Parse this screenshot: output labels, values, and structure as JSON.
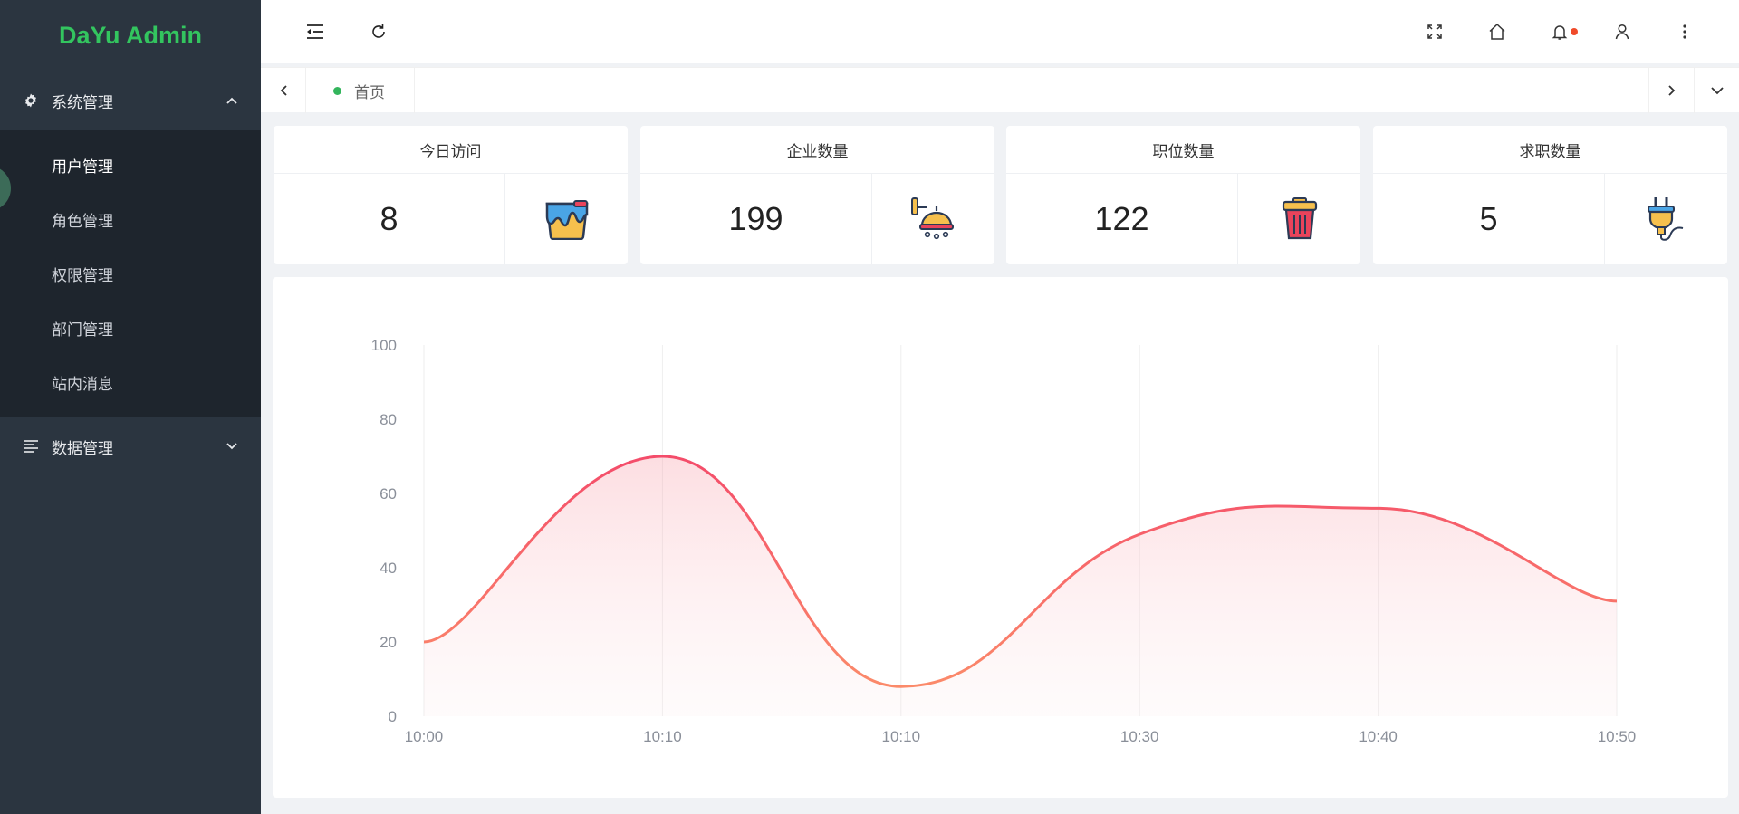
{
  "app": {
    "brand": "DaYu Admin"
  },
  "sidebar": {
    "groups": [
      {
        "label": "系统管理",
        "icon": "gear-icon",
        "expanded": true,
        "items": [
          {
            "label": "用户管理",
            "active": true
          },
          {
            "label": "角色管理"
          },
          {
            "label": "权限管理"
          },
          {
            "label": "部门管理"
          },
          {
            "label": "站内消息"
          }
        ]
      },
      {
        "label": "数据管理",
        "icon": "list-icon",
        "expanded": false
      }
    ]
  },
  "topbar": {
    "left_icons": [
      "menu-fold-icon",
      "refresh-icon"
    ],
    "right_icons": [
      "fullscreen-icon",
      "home-icon",
      "bell-icon",
      "user-icon",
      "more-vertical-icon"
    ],
    "notification_dot": true
  },
  "tabs": {
    "items": [
      {
        "label": "首页",
        "active": true
      }
    ]
  },
  "stats": [
    {
      "title": "今日访问",
      "value": "8",
      "icon": "paint-bucket-icon"
    },
    {
      "title": "企业数量",
      "value": "199",
      "icon": "shower-icon"
    },
    {
      "title": "职位数量",
      "value": "122",
      "icon": "trash-can-icon"
    },
    {
      "title": "求职数量",
      "value": "5",
      "icon": "plug-icon"
    }
  ],
  "colors": {
    "brand": "#33c55f",
    "sidebar": "#2b3540",
    "submenu": "#1e252d",
    "line": "#f5606f",
    "accent_dot": "#33b55c"
  },
  "chart_data": {
    "type": "area",
    "categories": [
      "10:00",
      "10:10",
      "10:10",
      "10:30",
      "10:40",
      "10:50"
    ],
    "values": [
      20,
      70,
      8,
      49,
      56,
      31
    ],
    "ylim": [
      0,
      100
    ],
    "yticks": [
      "0",
      "20",
      "40",
      "60",
      "80",
      "100"
    ],
    "smooth": true,
    "grid": "vertical"
  }
}
